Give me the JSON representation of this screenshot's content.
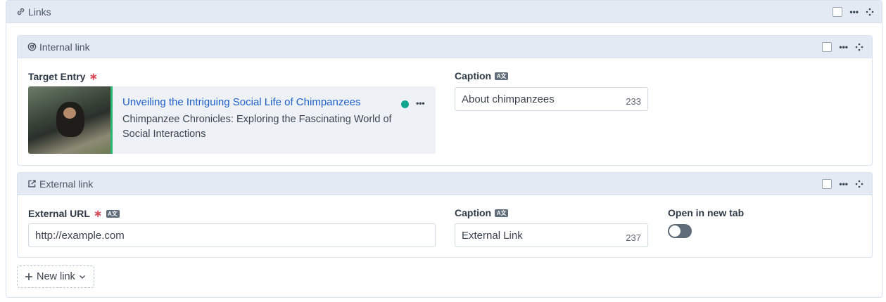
{
  "links_block": {
    "title": "Links",
    "icon": "link-icon",
    "actions": {
      "menu": "•••"
    }
  },
  "internal_link": {
    "title": "Internal link",
    "icon": "target-icon",
    "menu": "•••",
    "target_entry": {
      "label": "Target Entry",
      "required_mark": "∗",
      "entry": {
        "title": "Unveiling the Intriguing Social Life of Chimpanzees",
        "subtitle": "Chimpanzee Chronicles: Exploring the Fascinating World of Social Interactions",
        "status_color": "#10a58f",
        "menu": "•••"
      }
    },
    "caption": {
      "label": "Caption",
      "localized_badge": "A文",
      "value": "About chimpanzees",
      "count": "233"
    }
  },
  "external_link": {
    "title": "External link",
    "icon": "external-link-icon",
    "menu": "•••",
    "url": {
      "label": "External URL",
      "required_mark": "∗",
      "localized_badge": "A文",
      "value": "http://example.com"
    },
    "caption": {
      "label": "Caption",
      "localized_badge": "A文",
      "value": "External Link",
      "count": "237"
    },
    "new_tab": {
      "label": "Open in new tab",
      "checked": false
    }
  },
  "new_link_button": {
    "label": "New link",
    "plus": "+"
  },
  "colors": {
    "header_bg": "#e3eaf3",
    "link_blue": "#1d5fc7",
    "required_red": "#d94a5a"
  }
}
